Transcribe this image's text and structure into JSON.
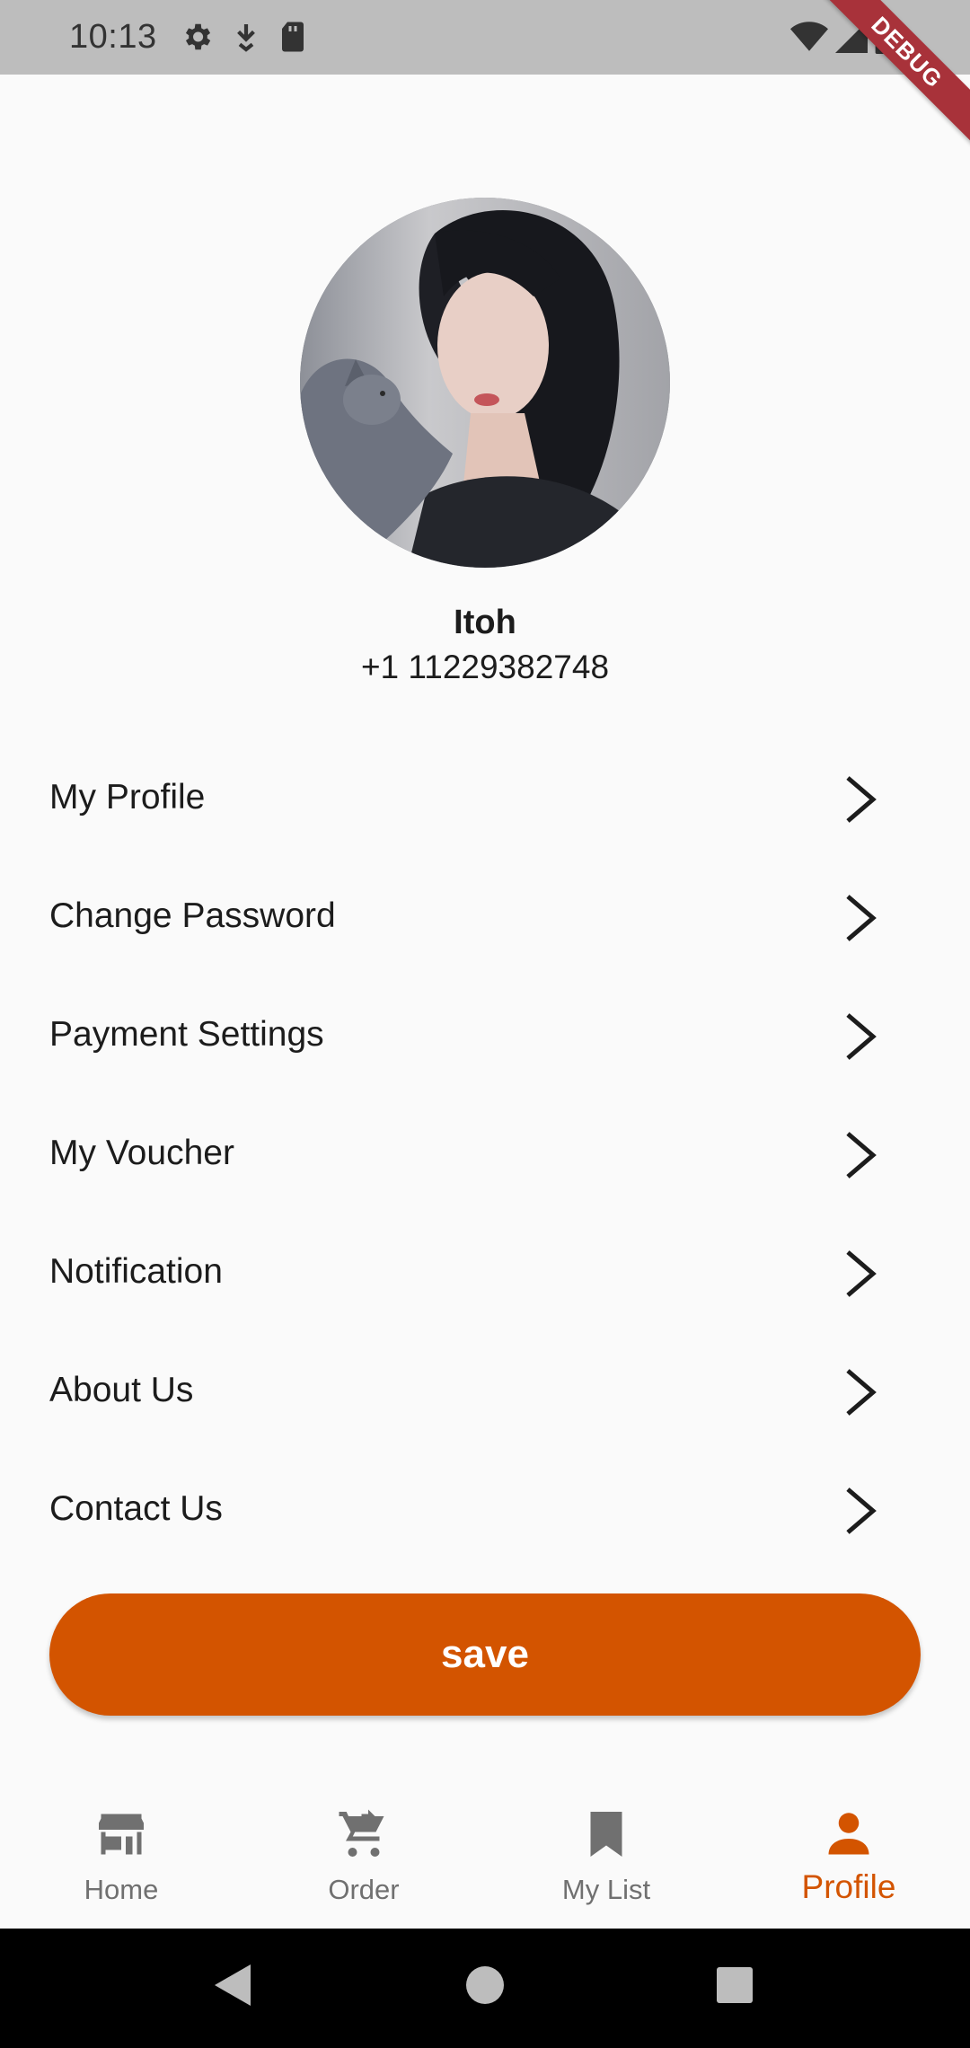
{
  "status_bar": {
    "time": "10:13",
    "left_icons": [
      "gear-icon",
      "download-icon",
      "sd-card-icon"
    ],
    "right_icons": [
      "wifi-icon",
      "signal-icon",
      "battery-icon"
    ],
    "debug_label": "DEBUG"
  },
  "profile": {
    "name": "Itoh",
    "phone": "+1 11229382748"
  },
  "menu": {
    "items": [
      {
        "label": "My Profile"
      },
      {
        "label": "Change Password"
      },
      {
        "label": "Payment Settings"
      },
      {
        "label": "My Voucher"
      },
      {
        "label": "Notification"
      },
      {
        "label": "About Us"
      },
      {
        "label": "Contact Us"
      }
    ]
  },
  "save_button": {
    "label": "save"
  },
  "bottom_nav": {
    "items": [
      {
        "label": "Home",
        "icon": "store-icon",
        "active": false
      },
      {
        "label": "Order",
        "icon": "cart-icon",
        "active": false
      },
      {
        "label": "My List",
        "icon": "bookmark-icon",
        "active": false
      },
      {
        "label": "Profile",
        "icon": "person-icon",
        "active": true
      }
    ]
  },
  "colors": {
    "accent": "#d35400",
    "nav_inactive": "#707070",
    "status_bar": "#bdbdbd",
    "debug_banner": "#a8323a"
  }
}
